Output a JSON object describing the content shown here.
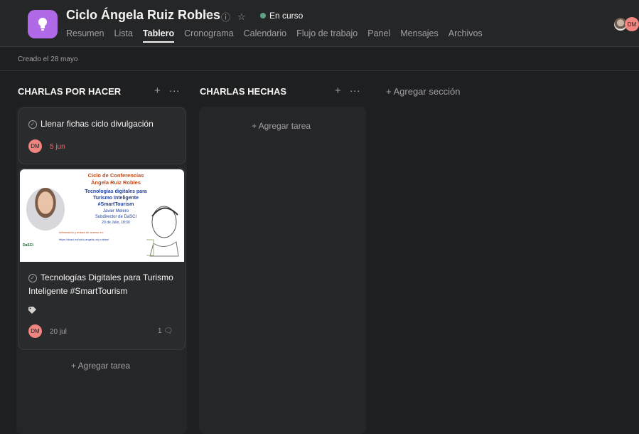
{
  "project": {
    "title": "Ciclo Ángela Ruiz Robles",
    "status": "En curso",
    "status_color": "#5da283",
    "icon": "lightbulb-icon",
    "icon_color": "#b16ae7"
  },
  "tabs": [
    {
      "label": "Resumen",
      "active": false
    },
    {
      "label": "Lista",
      "active": false
    },
    {
      "label": "Tablero",
      "active": true
    },
    {
      "label": "Cronograma",
      "active": false
    },
    {
      "label": "Calendario",
      "active": false
    },
    {
      "label": "Flujo de trabajo",
      "active": false
    },
    {
      "label": "Panel",
      "active": false
    },
    {
      "label": "Mensajes",
      "active": false
    },
    {
      "label": "Archivos",
      "active": false
    }
  ],
  "header_user_initials": "DM",
  "created": "Creado el 28 mayo",
  "columns": [
    {
      "title": "CHARLAS POR HACER",
      "add_task": "+ Agregar tarea"
    },
    {
      "title": "CHARLAS HECHAS",
      "add_task": "+ Agregar tarea"
    }
  ],
  "add_section": "+ Agregar sección",
  "cards": [
    {
      "title": "Llenar fichas ciclo divulgación",
      "assignee": "DM",
      "due": "5 jun",
      "due_color": "#f06a6a"
    },
    {
      "title_line1": "Tecnologías Digitales para Turismo",
      "title_line2": "Inteligente #SmartTourism",
      "assignee": "DM",
      "due": "20 jul",
      "comments": "1",
      "cover": {
        "line1": "Ciclo de Conferencias",
        "line2": "Ángela Ruiz Robles",
        "line3": "Tecnologías digitales para",
        "line4": "Turismo Inteligente",
        "line5": "#SmartTourism",
        "line6": "Javier Melero",
        "line7": "Subdirector de DaSCI",
        "line8": "20 de Julio, 18:30",
        "line9": "Información y enlace de acceso en:",
        "line10": "https://dasci.es/ciclo-angela-ruiz-robles/",
        "logo": "DaSCI"
      }
    }
  ]
}
